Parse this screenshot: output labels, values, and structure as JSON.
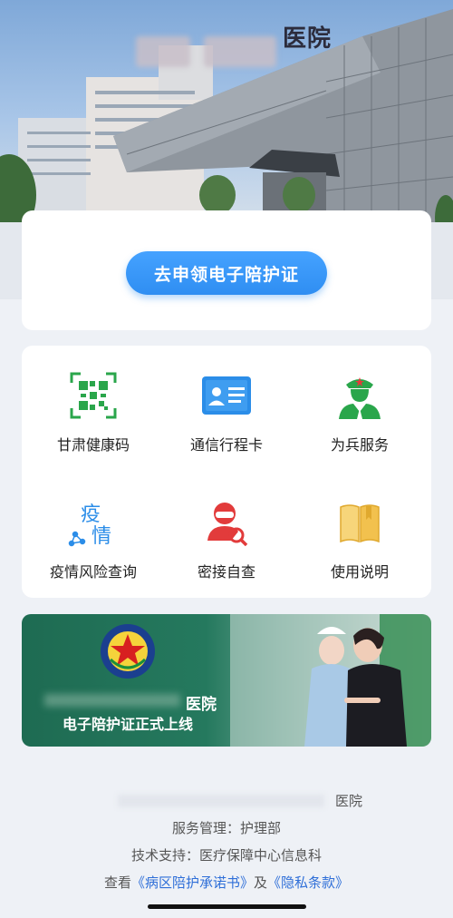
{
  "hero": {
    "sign_text": "医院"
  },
  "apply_button": {
    "label": "去申领电子陪护证"
  },
  "grid": [
    {
      "label": "甘肃健康码",
      "icon": "qr-code-icon"
    },
    {
      "label": "通信行程卡",
      "icon": "id-card-icon"
    },
    {
      "label": "为兵服务",
      "icon": "soldier-icon"
    },
    {
      "label": "疫情风险查询",
      "icon": "epidemic-icon"
    },
    {
      "label": "密接自查",
      "icon": "contact-check-icon"
    },
    {
      "label": "使用说明",
      "icon": "book-icon"
    }
  ],
  "epidemic_icon_text": [
    "疫",
    "情"
  ],
  "banner": {
    "line1": "医院",
    "line2": "电子陪护证正式上线",
    "logo_icon": "military-emblem-icon"
  },
  "footer": {
    "hospital": "医院",
    "management": "服务管理：护理部",
    "support": "技术支持：医疗保障中心信息科",
    "view_prefix": "查看",
    "commitment_link": "《病区陪护承诺书》",
    "and": "及",
    "privacy_link": "《隐私条款》"
  },
  "colors": {
    "primary": "#2f8ef2",
    "green_icon": "#2aa64b",
    "blue_icon": "#2b8de8",
    "red_icon": "#e23b3b",
    "yellow_icon": "#f2c14e",
    "banner_green": "#1e6b52",
    "link": "#2f6fd8"
  }
}
